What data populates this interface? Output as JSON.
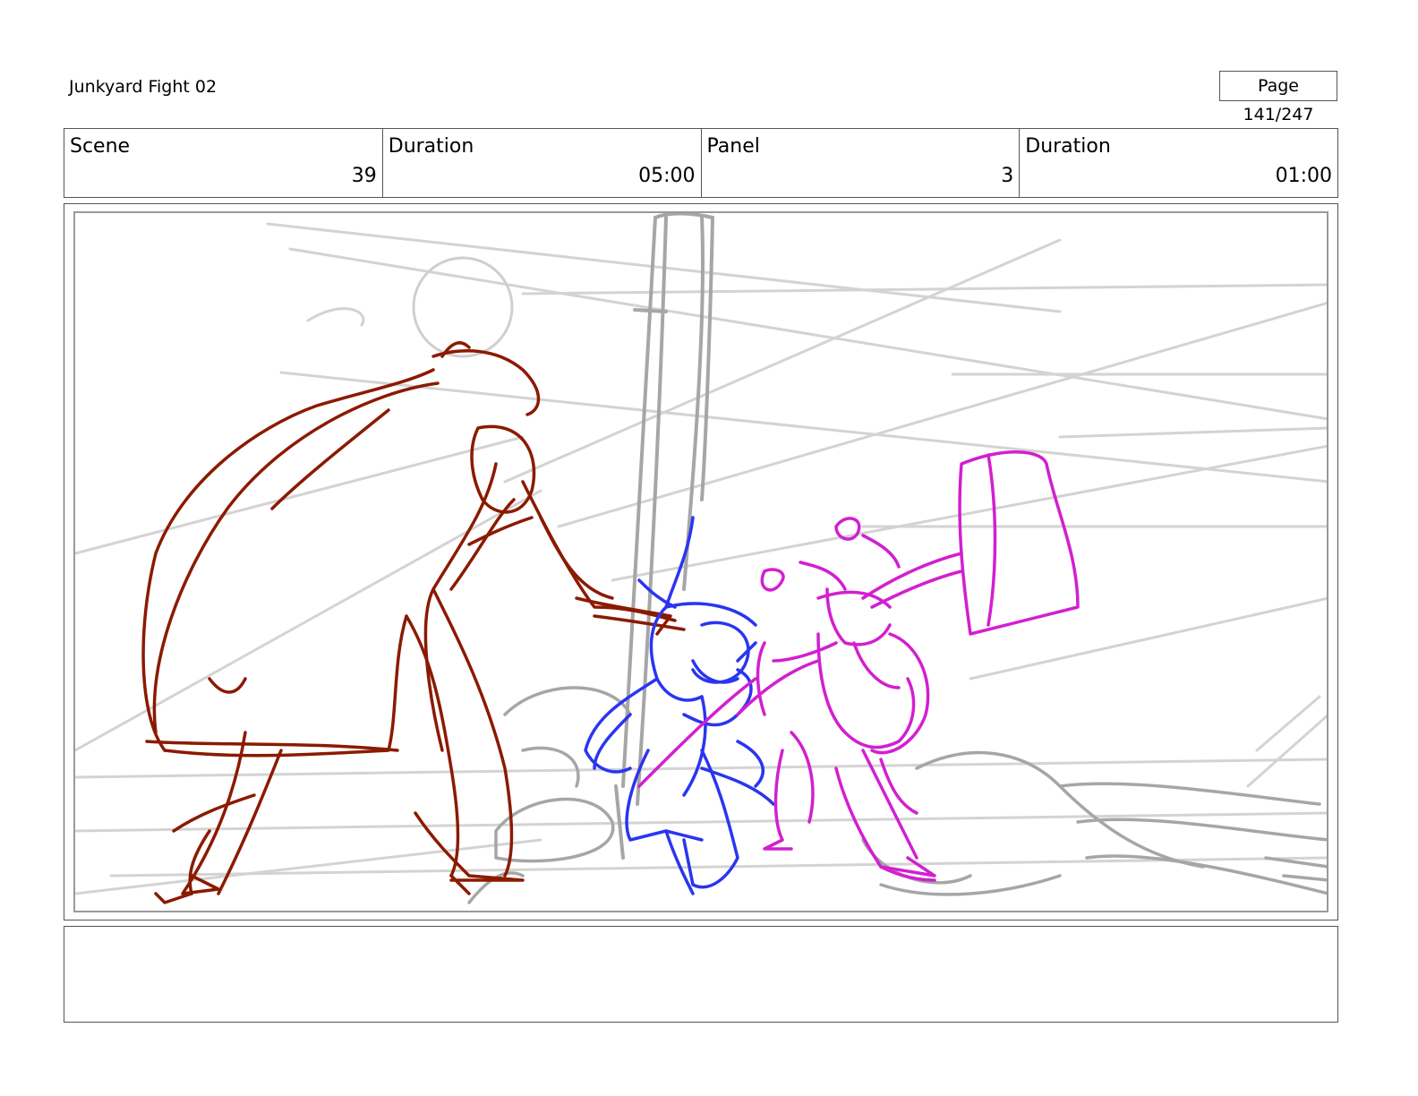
{
  "document": {
    "title": "Junkyard Fight 02",
    "page_label": "Page 141/247"
  },
  "info": {
    "scene_label": "Scene",
    "scene_value": "39",
    "scene_duration_label": "Duration",
    "scene_duration_value": "05:00",
    "panel_label": "Panel",
    "panel_value": "3",
    "panel_duration_label": "Duration",
    "panel_duration_value": "01:00"
  },
  "sketch": {
    "colors": {
      "background_lines": "#cfcfcf",
      "pole": "#a6a6a6",
      "red_character": "#8b1a00",
      "blue_character": "#2a35f0",
      "magenta_character": "#d21fd0"
    }
  },
  "notes": {
    "text": ""
  }
}
